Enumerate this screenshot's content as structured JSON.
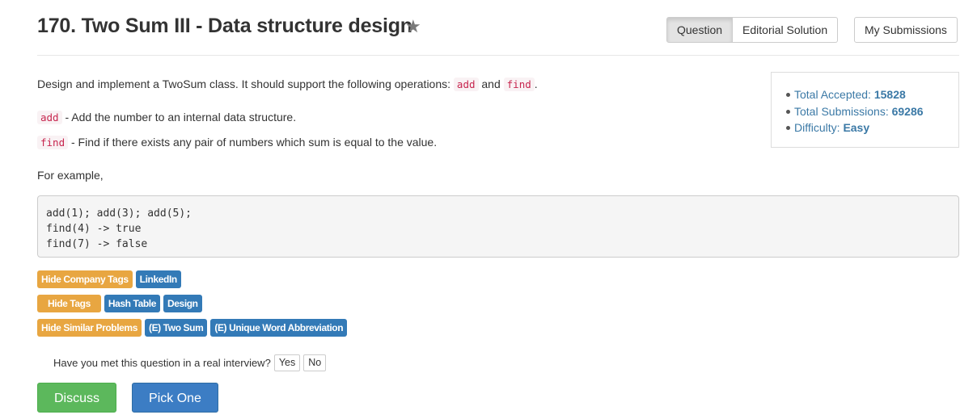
{
  "header": {
    "title": "170. Two Sum III - Data structure design",
    "star_icon": "star-icon",
    "tabs": [
      {
        "label": "Question",
        "active": true
      },
      {
        "label": "Editorial Solution",
        "active": false
      }
    ],
    "my_submissions_label": "My Submissions"
  },
  "description": {
    "intro_text": "Design and implement a TwoSum class. It should support the following operations:",
    "intro_code_1": "add",
    "intro_and": "and",
    "intro_code_2": "find",
    "intro_period": ".",
    "add_code": "add",
    "add_text": "- Add the number to an internal data structure.",
    "find_code": "find",
    "find_text": "- Find if there exists any pair of numbers which sum is equal to the value.",
    "example_heading": "For example,",
    "example_code": "add(1); add(3); add(5);\nfind(4) -> true\nfind(7) -> false"
  },
  "stats": {
    "accepted_label": "Total Accepted:",
    "accepted_value": "15828",
    "submissions_label": "Total Submissions:",
    "submissions_value": "69286",
    "difficulty_label": "Difficulty:",
    "difficulty_value": "Easy"
  },
  "tags": {
    "company_toggle": "Hide Company Tags",
    "companies": [
      "LinkedIn"
    ],
    "tags_toggle": "Hide Tags",
    "topics": [
      "Hash Table",
      "Design"
    ],
    "similar_toggle": "Hide Similar Problems",
    "similar": [
      "(E) Two Sum",
      "(E) Unique Word Abbreviation"
    ]
  },
  "interview": {
    "question": "Have you met this question in a real interview?",
    "yes_label": "Yes",
    "no_label": "No"
  },
  "actions": {
    "discuss_label": "Discuss",
    "pick_one_label": "Pick One"
  },
  "colors": {
    "tag_toggle": "#e8a641",
    "tag": "#337ab7",
    "discuss": "#5cb85c",
    "pick_one": "#3c7dc4",
    "stats_text": "#3b79a6"
  }
}
